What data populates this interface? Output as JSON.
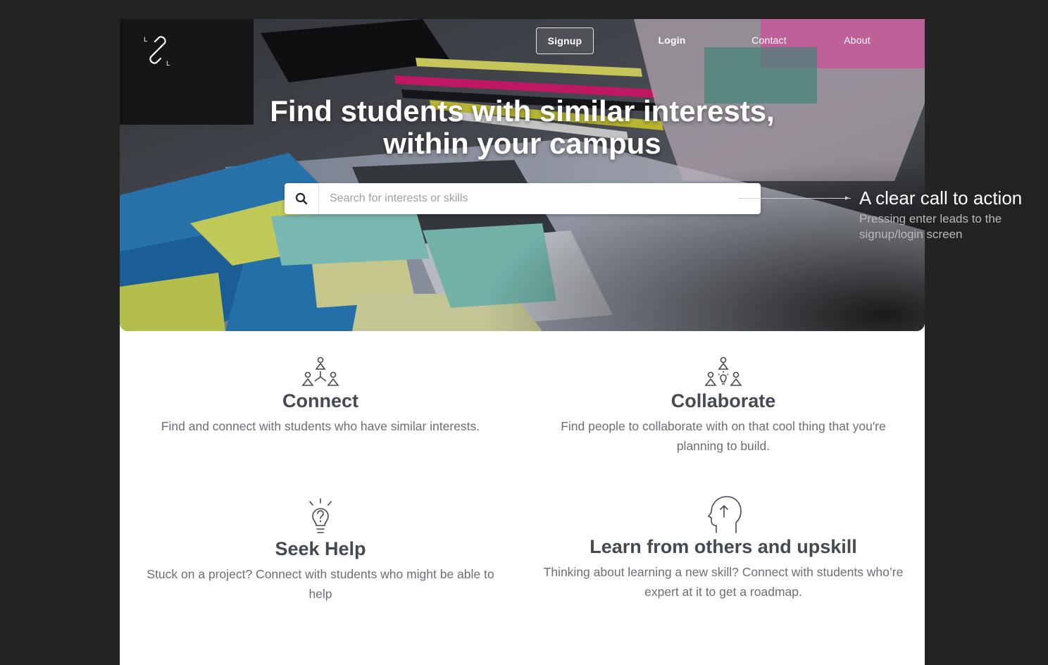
{
  "nav": {
    "signup": "Signup",
    "login": "Login",
    "contact": "Contact",
    "about": "About"
  },
  "logo": {
    "icon": "link-chain-icon",
    "letters": [
      "L",
      "L"
    ]
  },
  "hero": {
    "title_line1": "Find students with similar interests,",
    "title_line2": "within your campus",
    "background": "desk-with-sticky-notes-photo"
  },
  "search": {
    "icon": "search-icon",
    "placeholder": "Search for interests or skills",
    "value": ""
  },
  "annotation": {
    "title": "A clear call to action",
    "subtitle": "Pressing enter leads to the signup/login screen"
  },
  "features": [
    {
      "icon": "people-network-icon",
      "title": "Connect",
      "description": "Find and connect with students who have similar interests."
    },
    {
      "icon": "people-idea-icon",
      "title": "Collaborate",
      "description": "Find people to collaborate with on that cool thing that you're planning to build."
    },
    {
      "icon": "lightbulb-question-icon",
      "title": "Seek Help",
      "description": "Stuck on a project? Connect with students who might be able to help"
    },
    {
      "icon": "head-arrow-up-icon",
      "title": "Learn from others and upskill",
      "description": "Thinking about learning a new skill? Connect with students who’re expert at it to get a roadmap."
    }
  ],
  "colors": {
    "page_bg": "#232323",
    "card_bg": "#ffffff",
    "heading": "#444a52",
    "body_text": "#6b6f74"
  }
}
